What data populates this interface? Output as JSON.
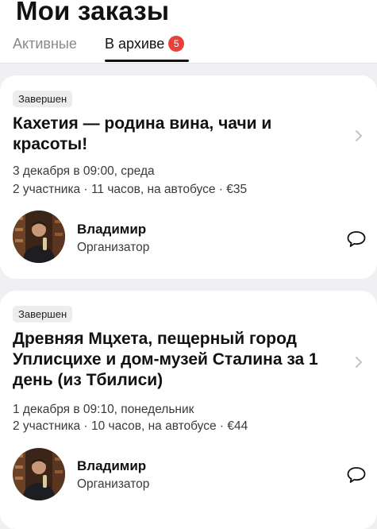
{
  "header": {
    "title": "Мои заказы",
    "tabs": [
      {
        "label": "Активные",
        "active": false
      },
      {
        "label": "В архиве",
        "active": true,
        "badge": "5"
      }
    ]
  },
  "orders": [
    {
      "status": "Завершен",
      "title": "Кахетия — родина вина, чачи и красоты!",
      "date": "3 декабря в 09:00, среда",
      "details": "2 участника · 11 часов, на автобусе · €35",
      "organizer": {
        "name": "Владимир",
        "role": "Организатор"
      }
    },
    {
      "status": "Завершен",
      "title": "Древняя Мцхета, пещерный город Уплисцихе и дом-музей Сталина за 1 день (из Тбилиси)",
      "date": "1 декабря в 09:10, понедельник",
      "details": "2 участника · 10 часов, на автобусе · €44",
      "organizer": {
        "name": "Владимир",
        "role": "Организатор"
      }
    }
  ],
  "icons": {
    "chevron": "chevron-right-icon",
    "chat": "chat-bubble-icon"
  },
  "colors": {
    "badge": "#e8413c",
    "page_bg": "#f0f0f3",
    "card_bg": "#ffffff"
  }
}
